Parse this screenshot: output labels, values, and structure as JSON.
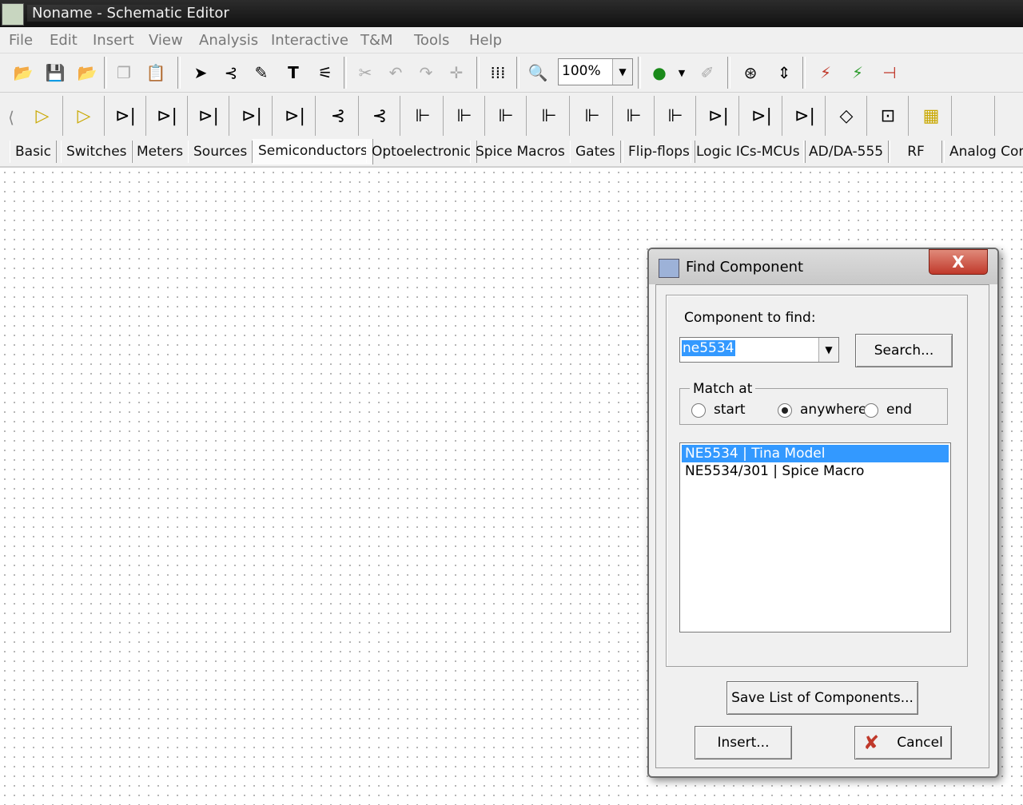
{
  "window": {
    "title": "Noname - Schematic Editor"
  },
  "menu": [
    "File",
    "Edit",
    "Insert",
    "View",
    "Analysis",
    "Interactive",
    "T&M",
    "Tools",
    "Help"
  ],
  "toolbar": {
    "zoom": "100%"
  },
  "tabs": [
    "Basic",
    "Switches",
    "Meters",
    "Sources",
    "Semiconductors",
    "Optoelectronic",
    "Spice Macros",
    "Gates",
    "Flip-flops",
    "Logic ICs-MCUs",
    "AD/DA-555",
    "RF",
    "Analog Con"
  ],
  "active_tab": "Semiconductors",
  "dialog": {
    "title": "Find Component",
    "close_label": "X",
    "find_label": "Component to find:",
    "search_value": "ne5534",
    "search_button": "Search...",
    "match_legend": "Match at",
    "match_options": [
      "start",
      "anywhere",
      "end"
    ],
    "match_selected": "anywhere",
    "results": [
      "NE5534 | Tina Model",
      "NE5534/301 | Spice Macro"
    ],
    "save_button": "Save List of Components...",
    "insert_button": "Insert...",
    "cancel_button": "Cancel"
  }
}
